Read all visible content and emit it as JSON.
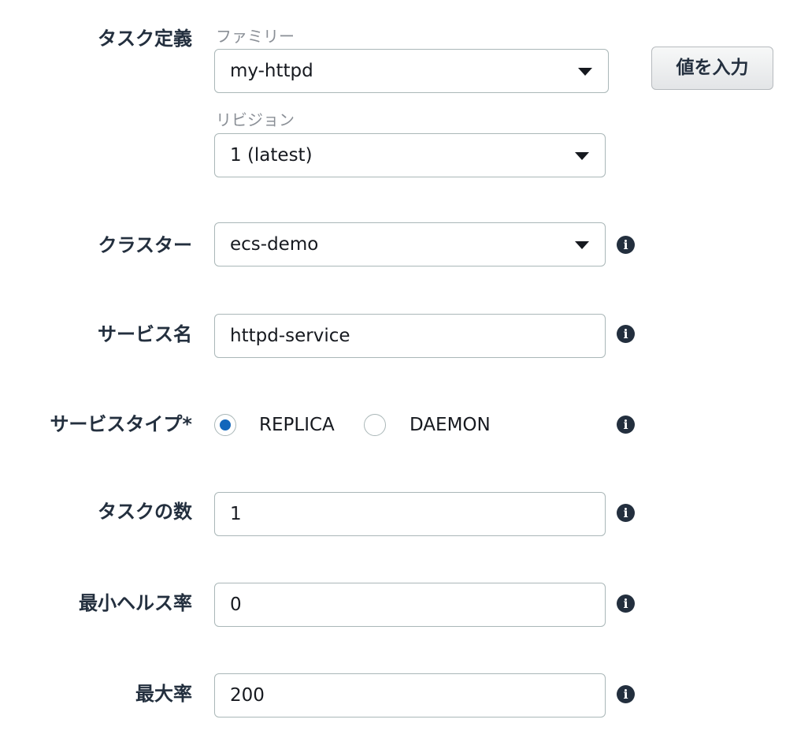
{
  "task_definition": {
    "label": "タスク定義",
    "family": {
      "label": "ファミリー",
      "value": "my-httpd"
    },
    "revision": {
      "label": "リビジョン",
      "value": "1 (latest)"
    },
    "enter_value_button": "値を入力"
  },
  "cluster": {
    "label": "クラスター",
    "value": "ecs-demo"
  },
  "service_name": {
    "label": "サービス名",
    "value": "httpd-service"
  },
  "service_type": {
    "label": "サービスタイプ*",
    "options": [
      "REPLICA",
      "DAEMON"
    ],
    "selected": "REPLICA"
  },
  "task_count": {
    "label": "タスクの数",
    "value": "1"
  },
  "min_healthy_percent": {
    "label": "最小ヘルス率",
    "value": "0"
  },
  "max_percent": {
    "label": "最大率",
    "value": "200"
  },
  "info_icon_glyph": "i",
  "colors": {
    "radio_selected": "#1166bb",
    "field_border": "#aab7b8",
    "label_text": "#232f3e"
  }
}
